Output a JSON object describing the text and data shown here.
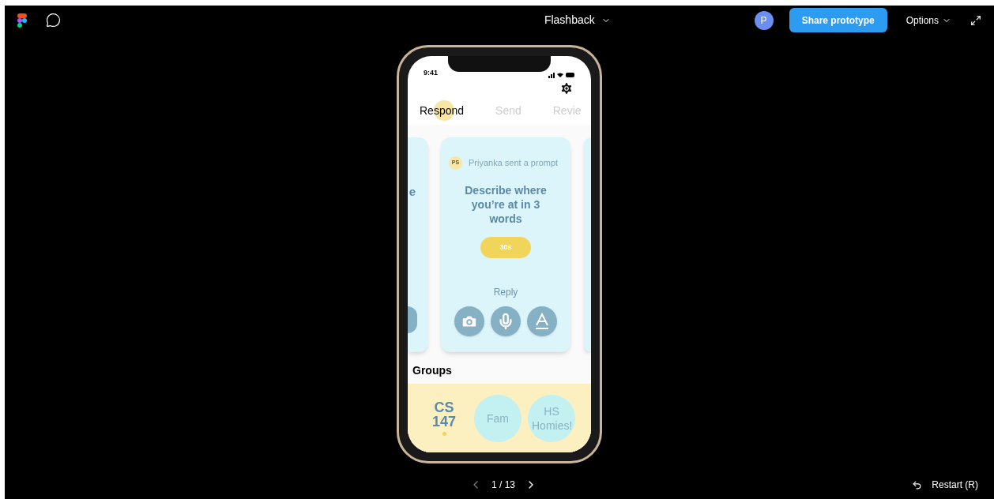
{
  "toolbar": {
    "title": "Flashback",
    "avatar": "P",
    "share_button": "Share prototype",
    "options": "Options"
  },
  "phone": {
    "time": "9:41",
    "tabs": [
      {
        "label": "Respond",
        "selected": true
      },
      {
        "label": "Send",
        "selected": false
      },
      {
        "label": "Revie",
        "selected": false
      }
    ],
    "left_card": {
      "text": "e"
    },
    "card": {
      "sender_initials": "PS",
      "sender_text": "Priyanka sent a prompt",
      "prompt": "Describe where you’re at in 3 words",
      "timer": "30s",
      "reply_label": "Reply"
    },
    "groups_heading": "Groups",
    "groups": [
      {
        "name": "CS 147",
        "selected": true
      },
      {
        "name": "Fam",
        "selected": false
      },
      {
        "name": "HS Homies!",
        "selected": false
      }
    ]
  },
  "footer": {
    "page": "1 / 13",
    "restart": "Restart (R)"
  }
}
